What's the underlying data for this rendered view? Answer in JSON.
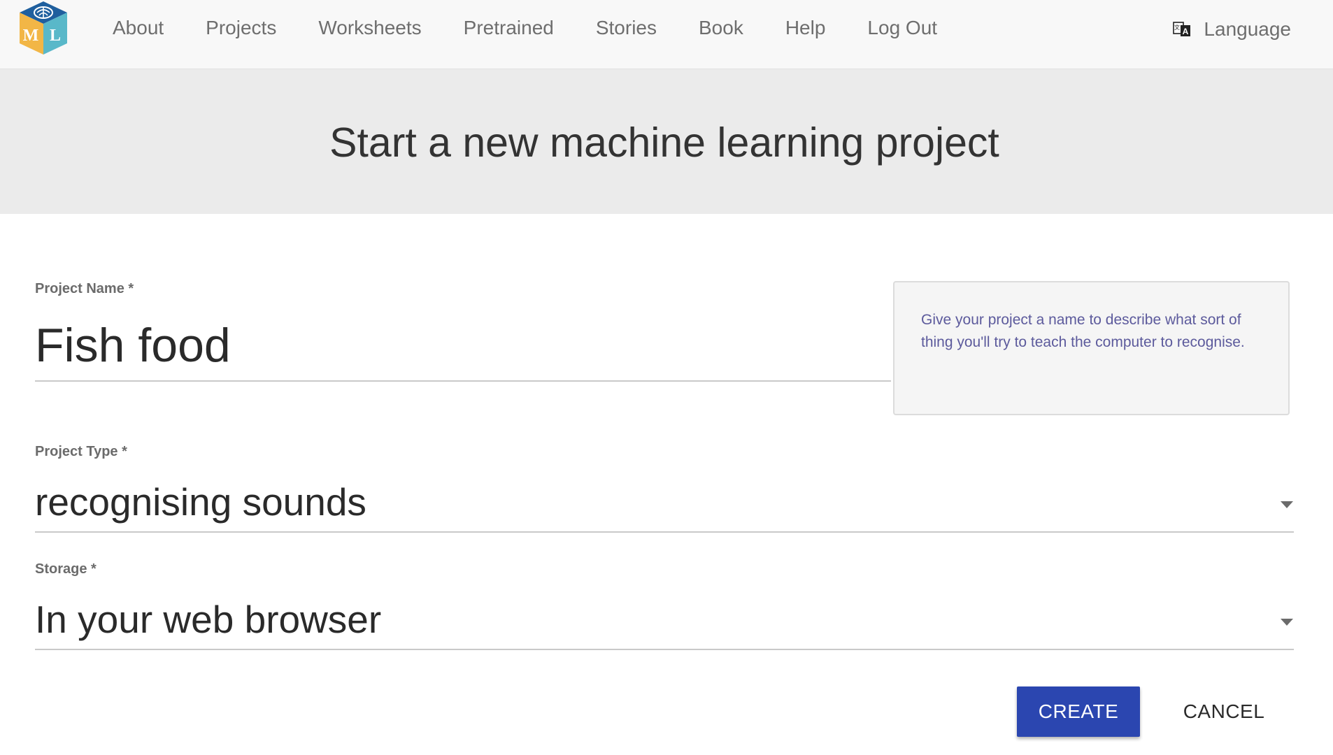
{
  "nav": {
    "logo_letters": [
      "M",
      "L"
    ],
    "links": [
      "About",
      "Projects",
      "Worksheets",
      "Pretrained",
      "Stories",
      "Book",
      "Help",
      "Log Out"
    ],
    "language_label": "Language",
    "language_icon": "translate-icon"
  },
  "header": {
    "title": "Start a new machine learning project"
  },
  "form": {
    "project_name": {
      "label": "Project Name *",
      "value": "Fish food"
    },
    "project_type": {
      "label": "Project Type *",
      "selected": "recognising sounds",
      "icon": "chevron-down-icon"
    },
    "storage": {
      "label": "Storage *",
      "selected": "In your web browser",
      "icon": "chevron-down-icon"
    },
    "help_text": "Give your project a name to describe what sort of thing you'll try to teach the computer to recognise."
  },
  "actions": {
    "create_label": "CREATE",
    "cancel_label": "CANCEL"
  },
  "colors": {
    "primary": "#2b46b0",
    "help_text": "#5c5a9c",
    "nav_bg": "#f8f8f8",
    "jumbotron_bg": "#ebebeb"
  }
}
